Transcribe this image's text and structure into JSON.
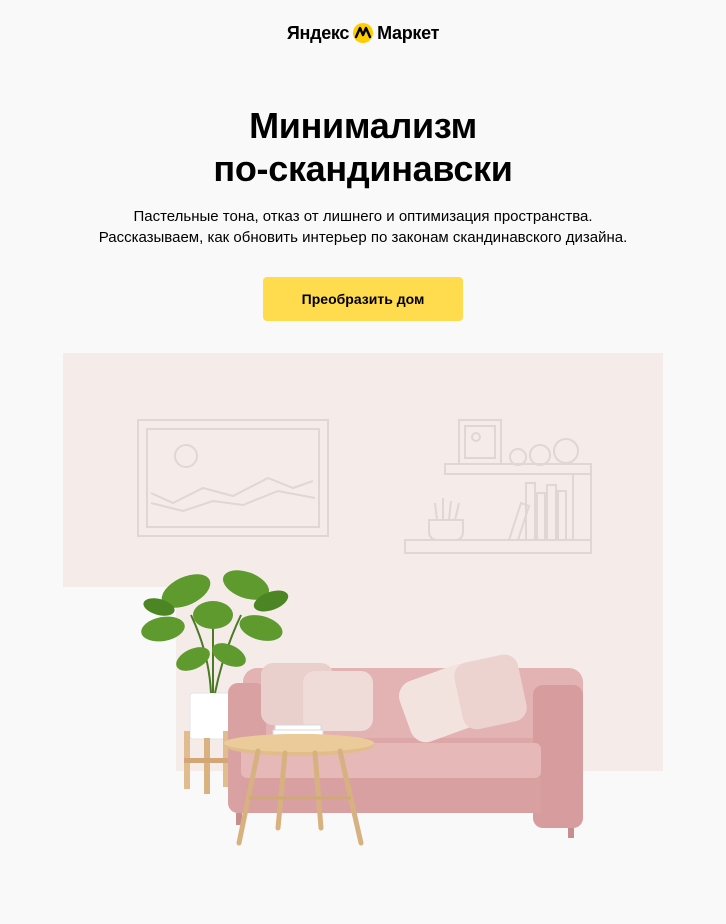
{
  "header": {
    "brand_left": "Яндекс",
    "brand_right": "Маркет",
    "logo_icon": "yandex-market-logo-icon"
  },
  "main": {
    "title_line1": "Минимализм",
    "title_line2": "по-скандинавски",
    "subtitle_line1": "Пастельные тона, отказ от лишнего и оптимизация пространства.",
    "subtitle_line2": "Рассказываем, как обновить интерьер по законам скандинавского дизайна.",
    "cta_label": "Преобразить дом"
  },
  "hero": {
    "description_icons": [
      "picture-frame-icon",
      "shelf-icon",
      "sofa",
      "plant",
      "coffee-table"
    ],
    "colors": {
      "backdrop": "#f5ecea",
      "line_art": "#e2d8d5",
      "sofa": "#dfaaab",
      "accent": "#ffdb4d"
    }
  }
}
